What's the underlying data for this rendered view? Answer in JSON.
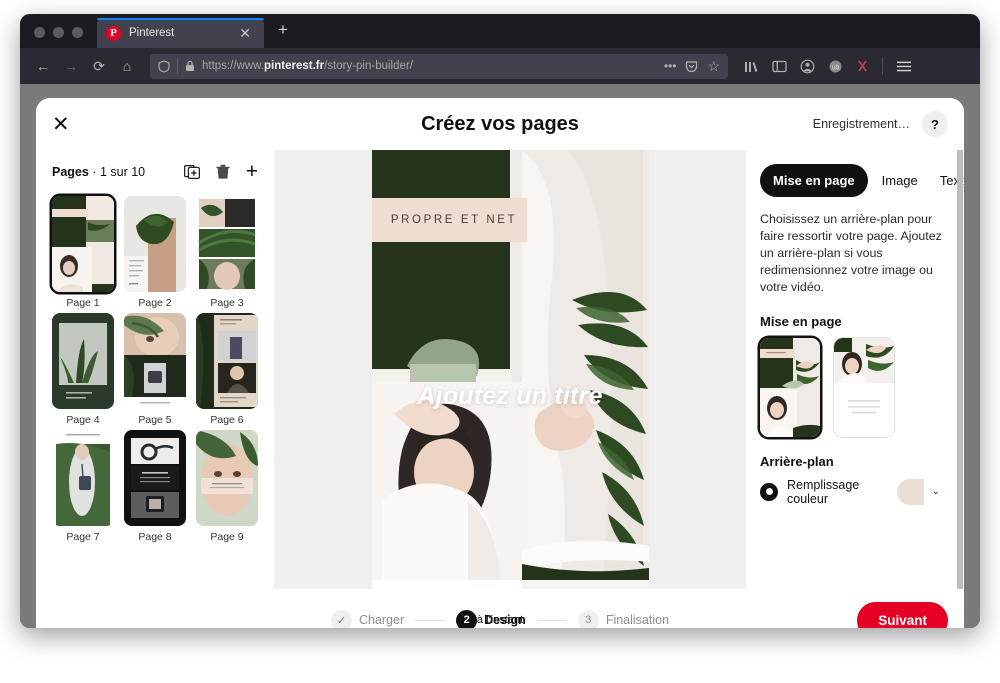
{
  "browser": {
    "tab": {
      "title": "Pinterest",
      "favicon": "pinterest-icon",
      "close": "✕"
    },
    "new_tab": "+",
    "nav": {
      "back": "←",
      "forward": "→",
      "reload": "⟳",
      "home": "⌂"
    },
    "url": {
      "scheme": "https://www.",
      "domain": "pinterest.fr",
      "path": "/story-pin-builder/"
    },
    "url_icons": {
      "shield": "shield-icon",
      "lock": "lock-icon",
      "more": "•••",
      "pocket": "pocket-icon",
      "bookmark": "☆"
    },
    "toolbar_icons": [
      "library-icon",
      "sidebar-icon",
      "account-icon",
      "extension-icon",
      "addon-icon",
      "menu-icon"
    ]
  },
  "modal": {
    "close_label": "✕",
    "title": "Créez vos pages",
    "saving_status": "Enregistrement…",
    "help_label": "?"
  },
  "pages": {
    "label_strong": "Pages",
    "label_rest": " · 1 sur 10",
    "actions": [
      {
        "name": "duplicate-page-button",
        "glyph": "duplicate-icon"
      },
      {
        "name": "delete-page-button",
        "glyph": "trash-icon"
      },
      {
        "name": "add-page-button",
        "glyph": "+"
      }
    ],
    "items": [
      {
        "label": "Page 1",
        "selected": true
      },
      {
        "label": "Page 2",
        "selected": false
      },
      {
        "label": "Page 3",
        "selected": false
      },
      {
        "label": "Page 4",
        "selected": false
      },
      {
        "label": "Page 5",
        "selected": false
      },
      {
        "label": "Page 6",
        "selected": false
      },
      {
        "label": "Page 7",
        "selected": false
      },
      {
        "label": "Page 8",
        "selected": false
      },
      {
        "label": "Page 9",
        "selected": false
      }
    ]
  },
  "canvas": {
    "overlay_text": "PROPRE ET NET",
    "title_placeholder": "Ajoutez un titre"
  },
  "right_panel": {
    "tabs": [
      {
        "label": "Mise en page",
        "active": true
      },
      {
        "label": "Image",
        "active": false
      },
      {
        "label": "Texte",
        "active": false
      }
    ],
    "description": "Choisissez un arrière-plan pour faire ressortir votre page. Ajoutez un arrière-plan si vous redimensionnez votre image ou votre vidéo.",
    "layout_section_title": "Mise en page",
    "layout_options": [
      {
        "name": "layout-option-1",
        "selected": true
      },
      {
        "name": "layout-option-2",
        "selected": false
      }
    ],
    "background_section_title": "Arrière-plan",
    "background_option_label": "Remplissage couleur",
    "background_color": "#e9ded6",
    "chevron": "⌄"
  },
  "footer": {
    "steps": [
      {
        "badge": "✓",
        "label": "Charger",
        "state": "done"
      },
      {
        "badge": "2",
        "label": "Design",
        "state": "active"
      },
      {
        "badge": "3",
        "label": "Finalisation",
        "state": "todo"
      }
    ],
    "next_label": "Suivant",
    "toast": "à l'instant"
  },
  "colors": {
    "brand_red": "#e60023",
    "dark_green": "#24331a",
    "blush": "#f0ddd2",
    "accent_black": "#111111"
  }
}
